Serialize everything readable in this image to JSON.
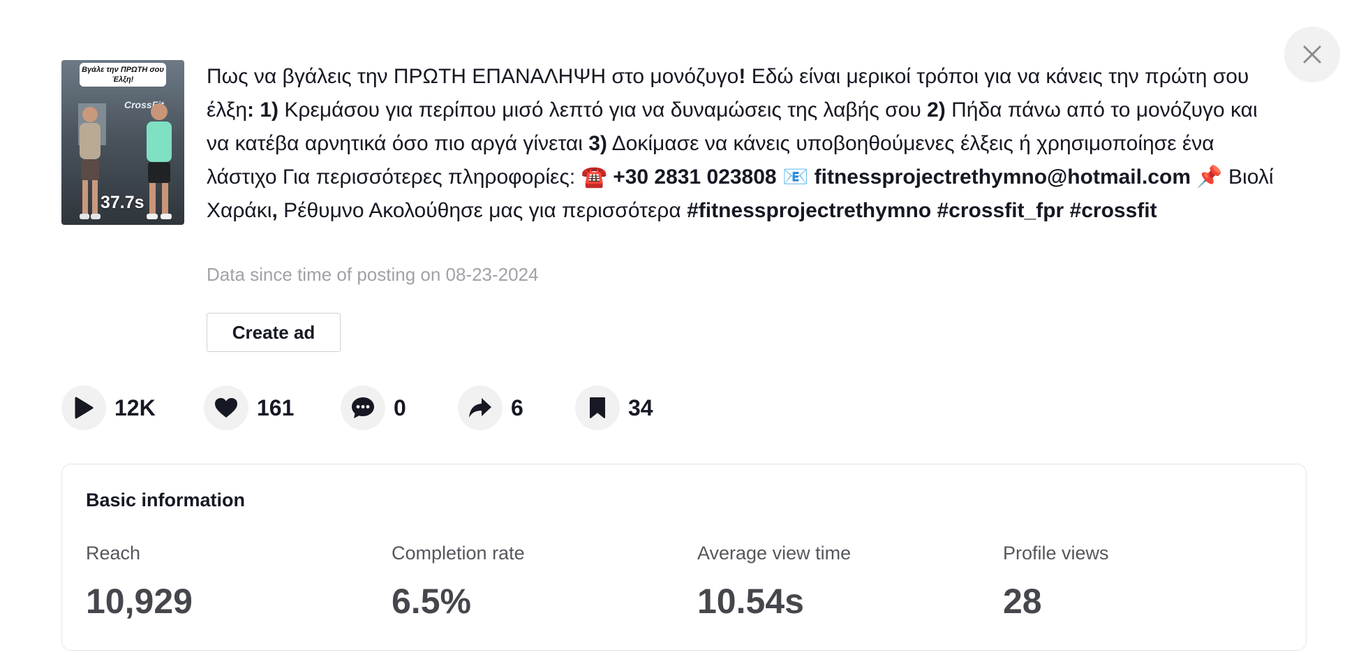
{
  "video": {
    "caption_overlay": "Βγάλε την ΠΡΩΤΗ σου Έλξη!",
    "duration": "37.7s",
    "brand_text": "CrossFit"
  },
  "description": {
    "p1": "Πως να βγάλεις την ΠΡΩΤΗ ΕΠΑΝΑΛΗΨΗ στο μονόζυγο",
    "b1": "!",
    "p2": " Εδώ είναι μερικοί τρόποι για να κάνεις την πρώτη σου έλξη",
    "b2": ": 1)",
    "p3": " Κρεμάσου για περίπου μισό λεπτό για να δυναμώσεις της λαβής σου ",
    "b3": "2)",
    "p4": " Πήδα πάνω από το μονόζυγο και να κατέβα αρνητικά όσο πιο αργά γίνεται ",
    "b4": "3)",
    "p5": " Δοκίμασε να κάνεις υποβοηθούμενες έλξεις ή χρησιμοποίησε ένα λάστιχο Για περισσότερες πληροφορίες: ",
    "phone_emoji": "☎️",
    "phone": " +30 2831 023808 ",
    "mail_emoji": "📧",
    "email": " fitnessprojectrethymno@hotmail.com",
    "pin_emoji": " 📌",
    "p6": " Βιολί Χαράκι",
    "b5": ",",
    "p7": " Ρέθυμνο Ακολούθησε μας για περισσότερα ",
    "hashtags": "#fitnessprojectrethymno #crossfit_fpr #crossfit"
  },
  "data_since": "Data since time of posting on 08-23-2024",
  "create_ad_label": "Create ad",
  "stats": {
    "plays": "12K",
    "likes": "161",
    "comments": "0",
    "shares": "6",
    "saves": "34"
  },
  "basic_info": {
    "title": "Basic information",
    "metrics": [
      {
        "label": "Reach",
        "value": "10,929"
      },
      {
        "label": "Completion rate",
        "value": "6.5%"
      },
      {
        "label": "Average view time",
        "value": "10.54s"
      },
      {
        "label": "Profile views",
        "value": "28"
      }
    ]
  },
  "icons": [
    "close-icon",
    "play-icon",
    "heart-icon",
    "comment-icon",
    "share-icon",
    "bookmark-icon"
  ]
}
